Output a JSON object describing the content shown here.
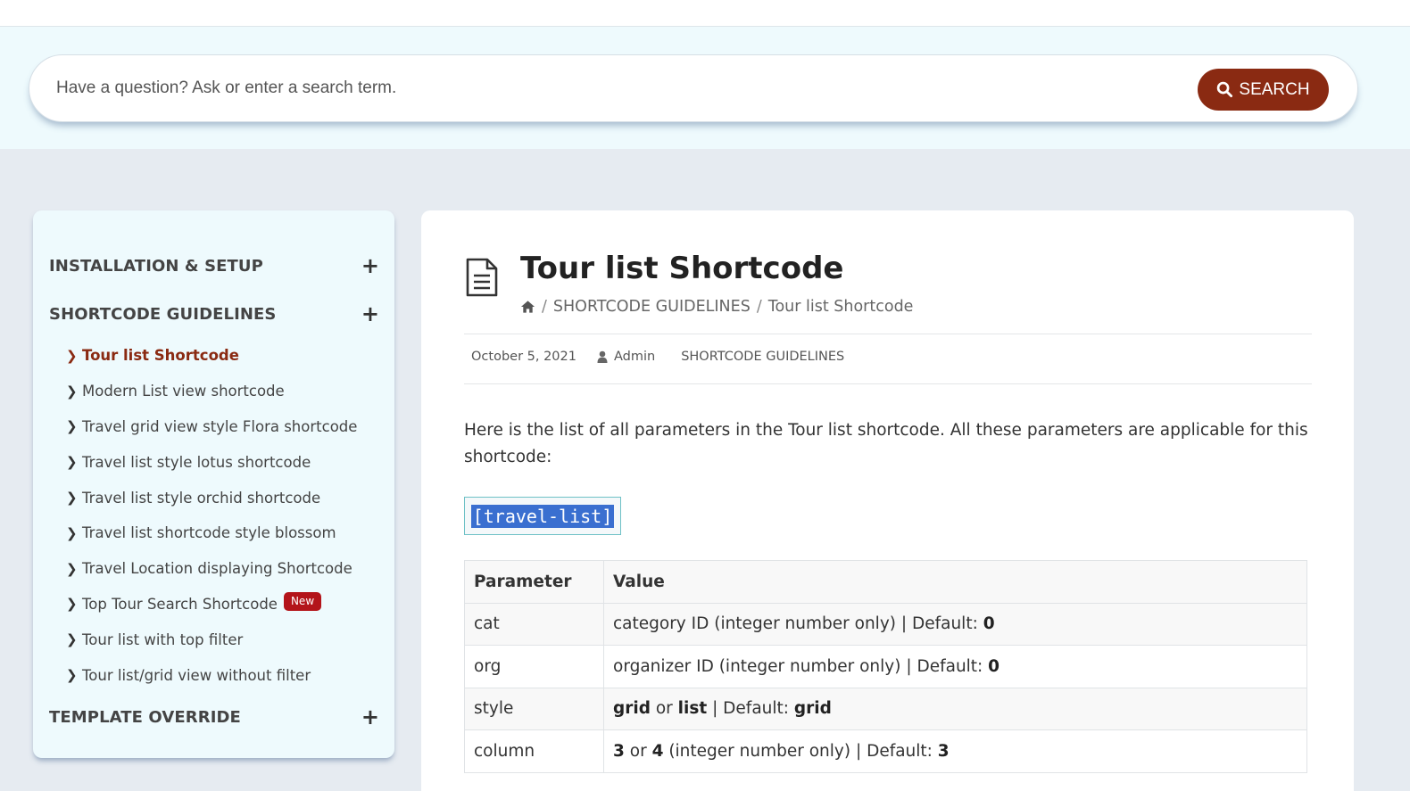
{
  "search": {
    "placeholder": "Have a question? Ask or enter a search term.",
    "button_label": "SEARCH"
  },
  "sidebar": {
    "categories": [
      {
        "title": "INSTALLATION & SETUP",
        "icon": "plus-icon"
      },
      {
        "title": "SHORTCODE GUIDELINES",
        "icon": "plus-icon"
      },
      {
        "title": "TEMPLATE OVERRIDE",
        "icon": "plus-icon"
      }
    ],
    "items": [
      {
        "label": "Tour list Shortcode",
        "active": true
      },
      {
        "label": "Modern List view shortcode"
      },
      {
        "label": "Travel grid view style Flora shortcode"
      },
      {
        "label": "Travel list style lotus shortcode"
      },
      {
        "label": "Travel list style orchid shortcode"
      },
      {
        "label": "Travel list shortcode style blossom"
      },
      {
        "label": "Travel Location displaying Shortcode"
      },
      {
        "label": "Top Tour Search Shortcode",
        "badge": "New"
      },
      {
        "label": "Tour list with top filter"
      },
      {
        "label": "Tour list/grid view without filter"
      }
    ]
  },
  "article": {
    "title": "Tour list Shortcode",
    "breadcrumb": [
      "SHORTCODE GUIDELINES",
      "Tour list Shortcode"
    ],
    "date": "October 5, 2021",
    "author": "Admin",
    "category": "SHORTCODE GUIDELINES",
    "intro": "Here is the list of all parameters in the Tour list shortcode. All these parameters are applicable for this shortcode:",
    "code": "[travel-list]",
    "table": {
      "headers": [
        "Parameter",
        "Value"
      ],
      "rows": [
        {
          "param": "cat",
          "value_parts": [
            [
              "category ID (integer number only) | Default: ",
              false
            ],
            [
              "0",
              true
            ]
          ]
        },
        {
          "param": "org",
          "value_parts": [
            [
              "organizer ID (integer number only) | Default: ",
              false
            ],
            [
              "0",
              true
            ]
          ]
        },
        {
          "param": "style",
          "value_parts": [
            [
              "grid",
              true
            ],
            [
              " or ",
              false
            ],
            [
              "list",
              true
            ],
            [
              " | Default: ",
              false
            ],
            [
              "grid",
              true
            ]
          ]
        },
        {
          "param": "column",
          "value_parts": [
            [
              "3",
              true
            ],
            [
              " or ",
              false
            ],
            [
              "4",
              true
            ],
            [
              " (integer number only) | Default: ",
              false
            ],
            [
              "3",
              true
            ]
          ]
        }
      ]
    }
  },
  "colors": {
    "accent": "#8a2a12",
    "badge": "#b3141a",
    "sidebar_bg": "#eefafd",
    "page_bg": "#e6ebf1"
  }
}
